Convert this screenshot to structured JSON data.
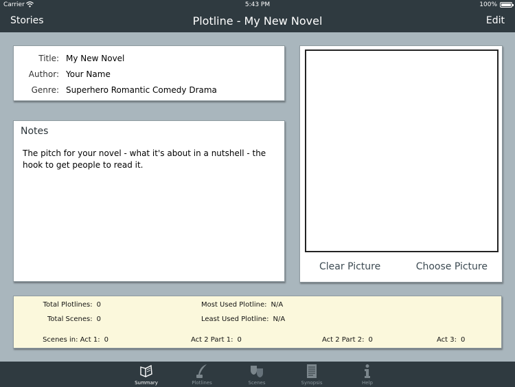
{
  "status_bar": {
    "carrier": "Carrier",
    "time": "5:43 PM",
    "battery": "100%"
  },
  "nav": {
    "left": "Stories",
    "title": "Plotline - My New Novel",
    "right": "Edit"
  },
  "info": {
    "title_label": "Title:",
    "title_value": "My New Novel",
    "author_label": "Author:",
    "author_value": "Your Name",
    "genre_label": "Genre:",
    "genre_value": "Superhero Romantic Comedy Drama"
  },
  "notes": {
    "heading": "Notes",
    "text": "The pitch for your novel - what it's about in a nutshell - the hook to get people to read it."
  },
  "picture": {
    "clear": "Clear Picture",
    "choose": "Choose Picture"
  },
  "stats": {
    "total_plotlines_label": "Total Plotlines:",
    "total_plotlines": "0",
    "total_scenes_label": "Total Scenes:",
    "total_scenes": "0",
    "most_used_label": "Most Used Plotline:",
    "most_used": "N/A",
    "least_used_label": "Least Used Plotline:",
    "least_used": "N/A",
    "act1_label": "Scenes in: Act 1:",
    "act1": "0",
    "act2p1_label": "Act 2 Part 1:",
    "act2p1": "0",
    "act2p2_label": "Act 2 Part 2:",
    "act2p2": "0",
    "act3_label": "Act 3:",
    "act3": "0"
  },
  "tabs": [
    {
      "label": "Summary",
      "icon": "open-book-icon",
      "active": true
    },
    {
      "label": "Plotlines",
      "icon": "quill-pen-icon",
      "active": false
    },
    {
      "label": "Scenes",
      "icon": "theater-masks-icon",
      "active": false
    },
    {
      "label": "Synopsis",
      "icon": "document-icon",
      "active": false
    },
    {
      "label": "Help",
      "icon": "info-icon",
      "active": false
    }
  ],
  "colors": {
    "bar": "#2f3a40",
    "background": "#a9b6bd",
    "stats_background": "#fbf8dc",
    "accent_text": "#3c4a52"
  }
}
